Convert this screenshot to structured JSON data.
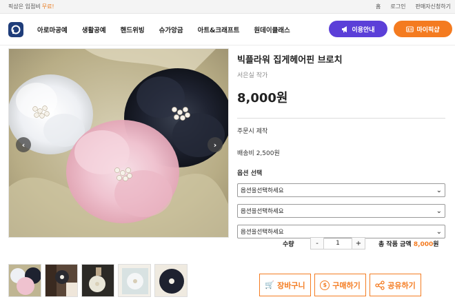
{
  "topbar": {
    "promo_text": "픽샵은 입점비",
    "promo_free": "무료!",
    "links": [
      "홈",
      "로그인",
      "판매자신청하기"
    ]
  },
  "header": {
    "logo_letter": "p",
    "nav": [
      "아로마공예",
      "생활공예",
      "핸드위빙",
      "슈가앙금",
      "아트&크래프트",
      "원데이클래스"
    ],
    "guide_button": "이용안내",
    "guide_icon": "megaphone-icon",
    "mypick_button": "마이픽샵",
    "mypick_icon": "id-card-icon"
  },
  "gallery": {
    "prev_icon": "chevron-left-icon",
    "next_icon": "chevron-right-icon",
    "prev_glyph": "‹",
    "next_glyph": "›",
    "thumbnail_count": 5
  },
  "product": {
    "title": "빅플라워 집게헤어핀 브로치",
    "artist": "서은실 작가",
    "price": "8,000원",
    "made_to_order": "주문시 제작",
    "shipping": "배송비 2,500원",
    "options_label": "옵션 선택",
    "option_placeholders": [
      "옵션을선택하세요",
      "옵션을선택하세요",
      "옵션을선택하세요"
    ]
  },
  "quantity": {
    "label": "수량",
    "minus": "-",
    "value": "1",
    "plus": "+"
  },
  "total": {
    "label": "총 작품 금액",
    "amount": "8,000",
    "unit": "원"
  },
  "actions": [
    {
      "label": "장바구니",
      "icon": "cart-icon",
      "glyph": "🛒"
    },
    {
      "label": "구매하기",
      "icon": "coin-icon",
      "glyph": "$"
    },
    {
      "label": "공유하기",
      "icon": "share-icon",
      "glyph": "<"
    }
  ],
  "colors": {
    "accent": "#f47b20",
    "purple": "#5b3fd8",
    "navy": "#1f3d7a"
  }
}
